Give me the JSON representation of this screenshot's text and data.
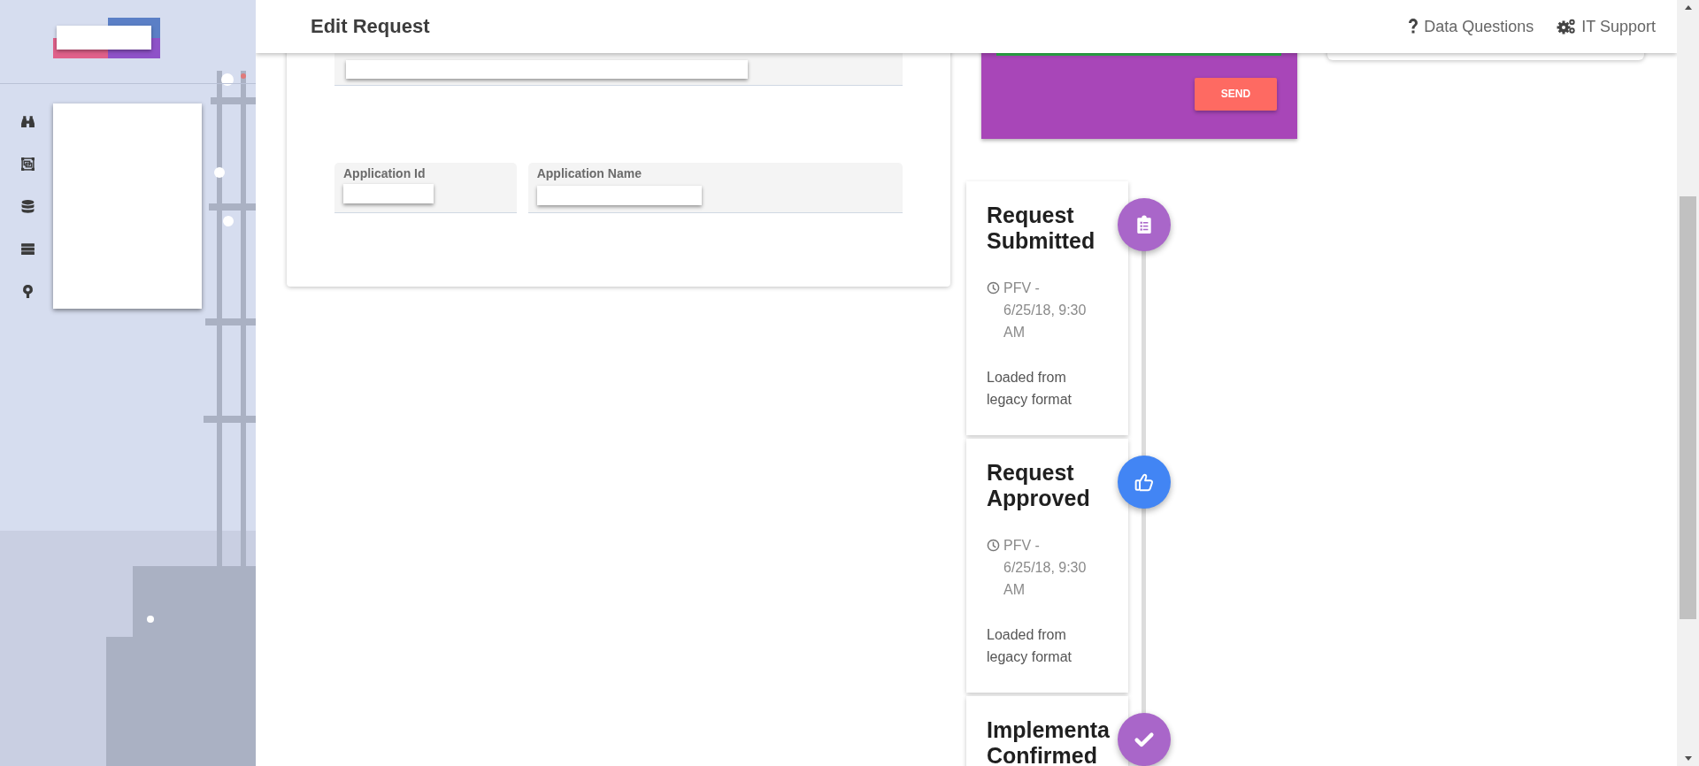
{
  "sidebar": {
    "background": {
      "kind": "oil-rig"
    },
    "nav_icons": [
      {
        "kind": "binoculars"
      },
      {
        "kind": "frame"
      },
      {
        "kind": "database"
      },
      {
        "kind": "server"
      },
      {
        "kind": "pin"
      }
    ]
  },
  "top_bar": {
    "title": "Edit Request",
    "links": [
      {
        "label": "Data Questions",
        "kind": "question"
      },
      {
        "label": "IT Support",
        "kind": "gears"
      }
    ]
  },
  "form": {
    "fields": [
      {
        "label": "Application Id"
      },
      {
        "label": "Application Name"
      }
    ]
  },
  "message_panel": {
    "button": "SEND"
  },
  "timeline": [
    {
      "title": "Request Submitted",
      "kind": "clipboard",
      "color": "#a966c9",
      "meta": "PFV - 6/25/18, 9:30 AM",
      "note": "Loaded from legacy format"
    },
    {
      "title": "Request Approved",
      "kind": "thumbs-up",
      "color": "#4285f4",
      "meta": "PFV - 6/25/18, 9:30 AM",
      "note": "Loaded from legacy format"
    },
    {
      "title": "Implementa Confirmed",
      "kind": "check",
      "color": "#a966c9"
    }
  ]
}
